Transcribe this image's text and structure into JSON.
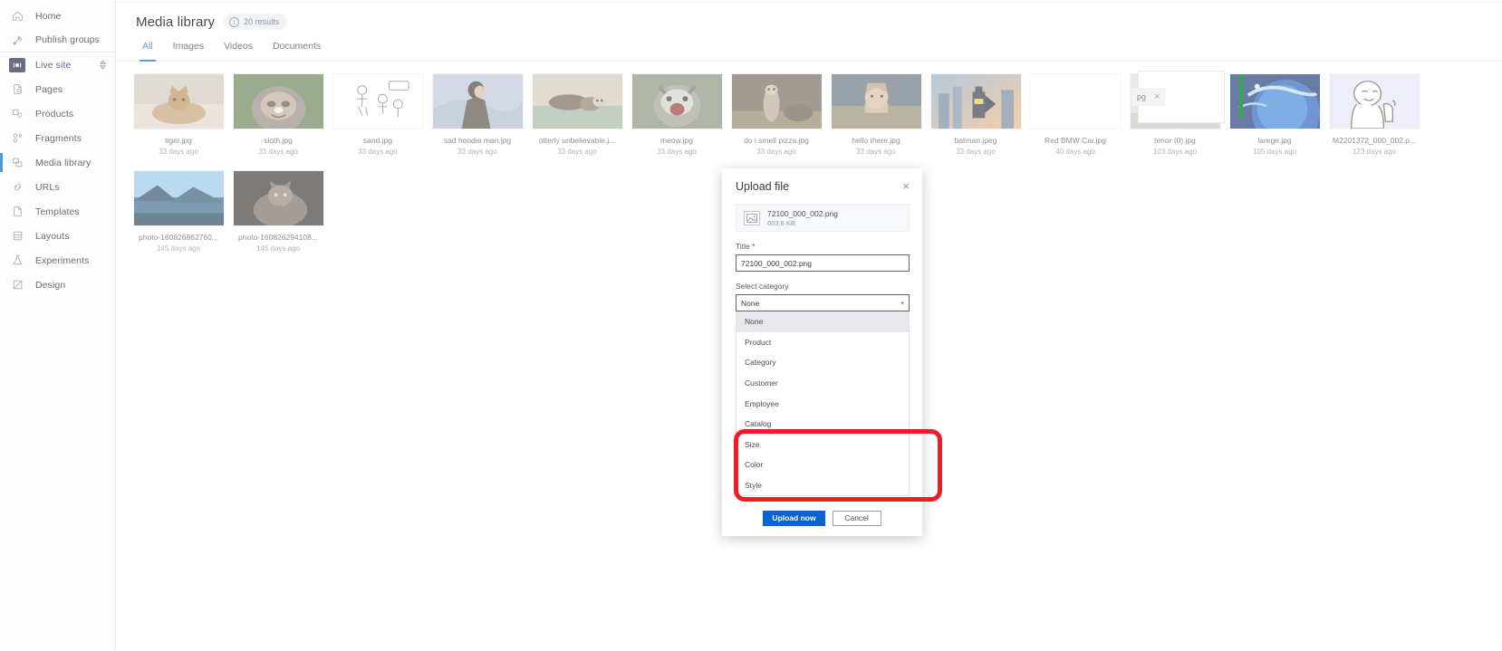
{
  "sidebar": {
    "items": [
      {
        "label": "Home",
        "icon": "home-icon",
        "key": "home"
      },
      {
        "label": "Publish groups",
        "icon": "publish-groups-icon",
        "key": "publish-groups"
      },
      {
        "label": "Live site",
        "icon": "live-site-icon",
        "key": "live-site"
      },
      {
        "label": "Pages",
        "icon": "pages-icon",
        "key": "pages"
      },
      {
        "label": "Products",
        "icon": "products-icon",
        "key": "products"
      },
      {
        "label": "Fragments",
        "icon": "fragments-icon",
        "key": "fragments"
      },
      {
        "label": "Media library",
        "icon": "media-library-icon",
        "key": "media-library"
      },
      {
        "label": "URLs",
        "icon": "urls-icon",
        "key": "urls"
      },
      {
        "label": "Templates",
        "icon": "templates-icon",
        "key": "templates"
      },
      {
        "label": "Layouts",
        "icon": "layouts-icon",
        "key": "layouts"
      },
      {
        "label": "Experiments",
        "icon": "experiments-icon",
        "key": "experiments"
      },
      {
        "label": "Design",
        "icon": "design-icon",
        "key": "design"
      }
    ]
  },
  "header": {
    "title": "Media library",
    "results_badge": "20 results",
    "info_glyph": "i"
  },
  "tabs": [
    {
      "label": "All",
      "active": true
    },
    {
      "label": "Images",
      "active": false
    },
    {
      "label": "Videos",
      "active": false
    },
    {
      "label": "Documents",
      "active": false
    }
  ],
  "media": [
    {
      "name": "tiger.jpg",
      "date": "33 days ago",
      "thumb": "cat-tabby"
    },
    {
      "name": "sloth.jpg",
      "date": "33 days ago",
      "thumb": "sloth"
    },
    {
      "name": "sand.jpg",
      "date": "33 days ago",
      "thumb": "sketch"
    },
    {
      "name": "sad hoodie man.jpg",
      "date": "33 days ago",
      "thumb": "hoodie"
    },
    {
      "name": "otterly unbelievable.j...",
      "date": "33 days ago",
      "thumb": "otters"
    },
    {
      "name": "meow.jpg",
      "date": "33 days ago",
      "thumb": "raccoon"
    },
    {
      "name": "do i smell pizza.jpg",
      "date": "33 days ago",
      "thumb": "otter-stand"
    },
    {
      "name": "hello there.jpg",
      "date": "33 days ago",
      "thumb": "obiwan"
    },
    {
      "name": "batman.jpeg",
      "date": "33 days ago",
      "thumb": "batman"
    },
    {
      "name": "Red BMW Car.jpg",
      "date": "40 days ago",
      "thumb": "blank"
    },
    {
      "name": "tenor (0).jpg",
      "date": "103 days ago",
      "thumb": "husky"
    },
    {
      "name": "larege.jpg",
      "date": "105 days ago",
      "thumb": "earth"
    },
    {
      "name": "M2201372_000_002.p...",
      "date": "123 days ago",
      "thumb": "meme-face"
    },
    {
      "name": "photo-160826862760...",
      "date": "145 days ago",
      "thumb": "mountain"
    },
    {
      "name": "photo-160826294108...",
      "date": "145 days ago",
      "thumb": "cat-dark"
    }
  ],
  "drop_card": {
    "chip_text": "pg",
    "close_glyph": "×"
  },
  "modal": {
    "title": "Upload file",
    "close_glyph": "×",
    "file": {
      "name": "72100_000_002.png",
      "size": "603.8 KB"
    },
    "title_field": {
      "label": "Title",
      "required_mark": "*",
      "value": "72100_000_002.png"
    },
    "category_field": {
      "label": "Select category",
      "selected": "None",
      "chevron": "▾",
      "options": [
        "None",
        "Product",
        "Category",
        "Customer",
        "Employee",
        "Catalog",
        "Size",
        "Color",
        "Style"
      ]
    },
    "buttons": {
      "primary": "Upload now",
      "secondary": "Cancel"
    }
  },
  "colors": {
    "accent_blue": "#0b63ce",
    "tab_active": "#5a9fd8",
    "annotation_red": "#ee1c25",
    "status_green": "#2fa84f",
    "required_red": "#da1414"
  }
}
